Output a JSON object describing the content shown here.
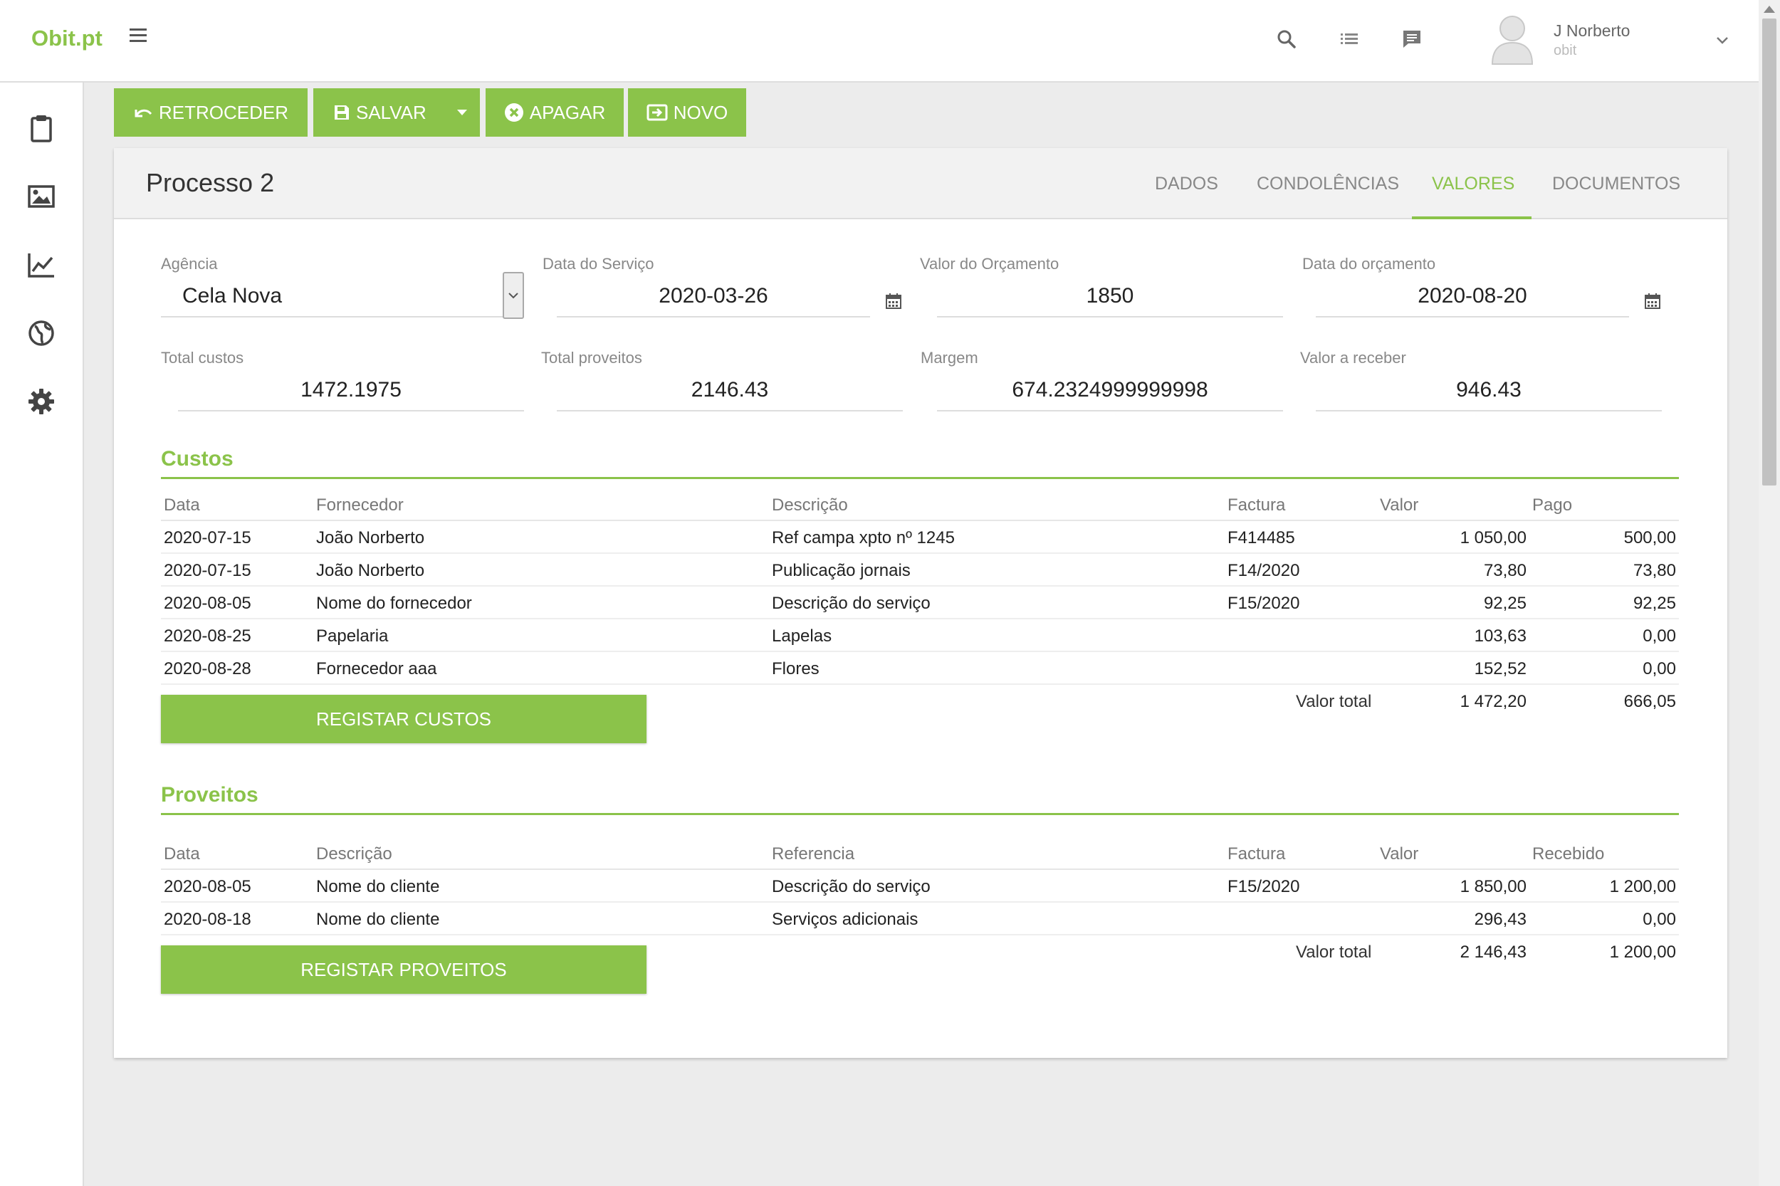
{
  "app": {
    "brand": "Obit.pt"
  },
  "header": {
    "user_name": "J Norberto",
    "user_subtitle": "obit"
  },
  "toolbar": {
    "back_label": "RETROCEDER",
    "save_label": "SALVAR",
    "delete_label": "APAGAR",
    "new_label": "NOVO"
  },
  "card": {
    "title": "Processo 2",
    "tabs": [
      "DADOS",
      "CONDOLÊNCIAS",
      "VALORES",
      "DOCUMENTOS"
    ],
    "active_tab": "VALORES"
  },
  "fields": {
    "agencia": {
      "label": "Agência",
      "value": "Cela Nova"
    },
    "data_servico": {
      "label": "Data do Serviço",
      "value": "2020-03-26"
    },
    "valor_orcamento": {
      "label": "Valor do Orçamento",
      "value": "1850"
    },
    "data_orcamento": {
      "label": "Data do orçamento",
      "value": "2020-08-20"
    },
    "total_custos": {
      "label": "Total custos",
      "value": "1472.1975"
    },
    "total_proveitos": {
      "label": "Total proveitos",
      "value": "2146.43"
    },
    "margem": {
      "label": "Margem",
      "value": "674.2324999999998"
    },
    "valor_receber": {
      "label": "Valor a receber",
      "value": "946.43"
    }
  },
  "custos": {
    "title": "Custos",
    "columns": [
      "Data",
      "Fornecedor",
      "Descrição",
      "Factura",
      "Valor",
      "Pago"
    ],
    "rows": [
      [
        "2020-07-15",
        "João Norberto",
        "Ref campa xpto nº 1245",
        "F414485",
        "1 050,00",
        "500,00"
      ],
      [
        "2020-07-15",
        "João Norberto",
        "Publicação jornais",
        "F14/2020",
        "73,80",
        "73,80"
      ],
      [
        "2020-08-05",
        "Nome do fornecedor",
        "Descrição do serviço",
        "F15/2020",
        "92,25",
        "92,25"
      ],
      [
        "2020-08-25",
        "Papelaria",
        "Lapelas",
        "",
        "103,63",
        "0,00"
      ],
      [
        "2020-08-28",
        "Fornecedor aaa",
        "Flores",
        "",
        "152,52",
        "0,00"
      ]
    ],
    "total_label": "Valor total",
    "total_valor": "1 472,20",
    "total_pago": "666,05",
    "button_label": "REGISTAR CUSTOS"
  },
  "proveitos": {
    "title": "Proveitos",
    "columns": [
      "Data",
      "Descrição",
      "Referencia",
      "Factura",
      "Valor",
      "Recebido"
    ],
    "rows": [
      [
        "2020-08-05",
        "Nome do cliente",
        "Descrição do serviço",
        "F15/2020",
        "1 850,00",
        "1 200,00"
      ],
      [
        "2020-08-18",
        "Nome do cliente",
        "Serviços adicionais",
        "",
        "296,43",
        "0,00"
      ]
    ],
    "total_label": "Valor total",
    "total_valor": "2 146,43",
    "total_recebido": "1 200,00",
    "button_label": "REGISTAR PROVEITOS"
  },
  "colors": {
    "accent": "#8bc34a",
    "header_bg": "#ffffff",
    "page_bg": "#ececec"
  },
  "icons": {
    "header": [
      "search-icon",
      "list-icon",
      "chat-icon"
    ],
    "sidebar": [
      "clipboard-icon",
      "image-icon",
      "chart-icon",
      "globe-icon",
      "gear-icon"
    ]
  }
}
